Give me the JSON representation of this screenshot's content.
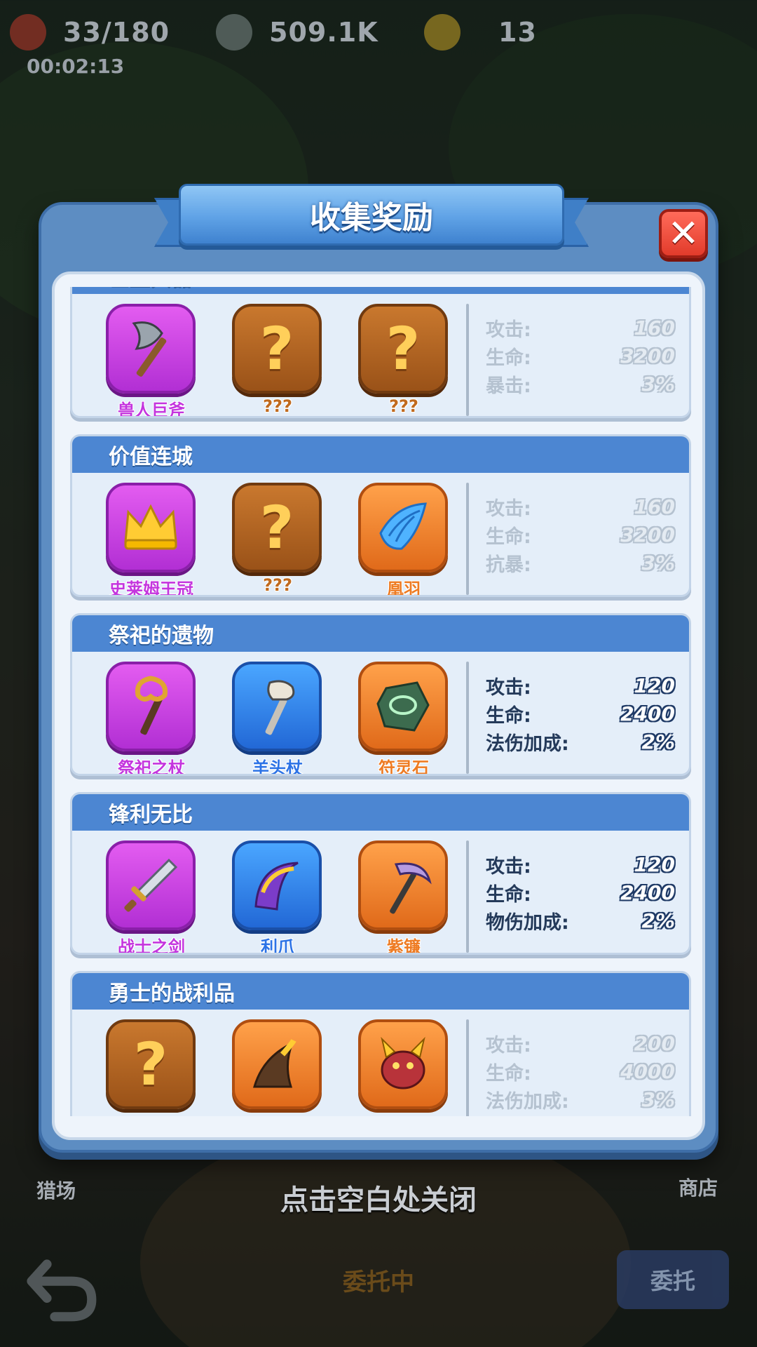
{
  "hud": {
    "resources": [
      {
        "value": "33/180",
        "icon": "energy-icon"
      },
      {
        "value": "509.1K",
        "icon": "silver-coin-icon"
      },
      {
        "value": "13",
        "icon": "gold-coin-icon"
      }
    ],
    "timer": "00:02:13"
  },
  "background": {
    "left_label": "猎场",
    "right_label": "商店",
    "close_hint": "点击空白处关闭",
    "task_status": "委托中",
    "entrust_button": "委托"
  },
  "modal": {
    "title": "收集奖励",
    "sets": [
      {
        "name": "巨型兵器",
        "items": [
          {
            "name": "兽人巨斧",
            "rarity": "purple",
            "icon": "axe-icon",
            "collected": true
          },
          {
            "name": "???",
            "rarity": "brown",
            "icon": "question-icon",
            "collected": false
          },
          {
            "name": "???",
            "rarity": "brown",
            "icon": "question-icon",
            "collected": false
          }
        ],
        "active": false,
        "stats": [
          {
            "label": "攻击:",
            "value": "160"
          },
          {
            "label": "生命:",
            "value": "3200"
          },
          {
            "label": "暴击:",
            "value": "3%"
          }
        ]
      },
      {
        "name": "价值连城",
        "items": [
          {
            "name": "史莱姆王冠",
            "rarity": "purple",
            "icon": "crown-icon",
            "collected": true
          },
          {
            "name": "???",
            "rarity": "brown",
            "icon": "question-icon",
            "collected": false
          },
          {
            "name": "凰羽",
            "rarity": "orange",
            "icon": "wing-icon",
            "collected": true
          }
        ],
        "active": false,
        "stats": [
          {
            "label": "攻击:",
            "value": "160"
          },
          {
            "label": "生命:",
            "value": "3200"
          },
          {
            "label": "抗暴:",
            "value": "3%"
          }
        ]
      },
      {
        "name": "祭祀的遗物",
        "items": [
          {
            "name": "祭祀之杖",
            "rarity": "purple",
            "icon": "scepter-icon",
            "collected": true
          },
          {
            "name": "羊头杖",
            "rarity": "blue",
            "icon": "ram-staff-icon",
            "collected": true
          },
          {
            "name": "符灵石",
            "rarity": "orange",
            "icon": "rune-stone-icon",
            "collected": true
          }
        ],
        "active": true,
        "stats": [
          {
            "label": "攻击:",
            "value": "120"
          },
          {
            "label": "生命:",
            "value": "2400"
          },
          {
            "label": "法伤加成:",
            "value": "2%"
          }
        ]
      },
      {
        "name": "锋利无比",
        "items": [
          {
            "name": "战士之剑",
            "rarity": "purple",
            "icon": "sword-icon",
            "collected": true
          },
          {
            "name": "利爪",
            "rarity": "blue",
            "icon": "claw-icon",
            "collected": true
          },
          {
            "name": "紫镰",
            "rarity": "orange",
            "icon": "scythe-icon",
            "collected": true
          }
        ],
        "active": true,
        "stats": [
          {
            "label": "攻击:",
            "value": "120"
          },
          {
            "label": "生命:",
            "value": "2400"
          },
          {
            "label": "物伤加成:",
            "value": "2%"
          }
        ]
      },
      {
        "name": "勇士的战利品",
        "items": [
          {
            "name": "",
            "rarity": "brown",
            "icon": "question-icon",
            "collected": false
          },
          {
            "name": "",
            "rarity": "orange",
            "icon": "horn-icon",
            "collected": true
          },
          {
            "name": "",
            "rarity": "orange",
            "icon": "dragon-head-icon",
            "collected": true
          }
        ],
        "active": false,
        "stats": [
          {
            "label": "攻击:",
            "value": "200"
          },
          {
            "label": "生命:",
            "value": "4000"
          },
          {
            "label": "法伤加成:",
            "value": "3%"
          }
        ]
      }
    ]
  }
}
